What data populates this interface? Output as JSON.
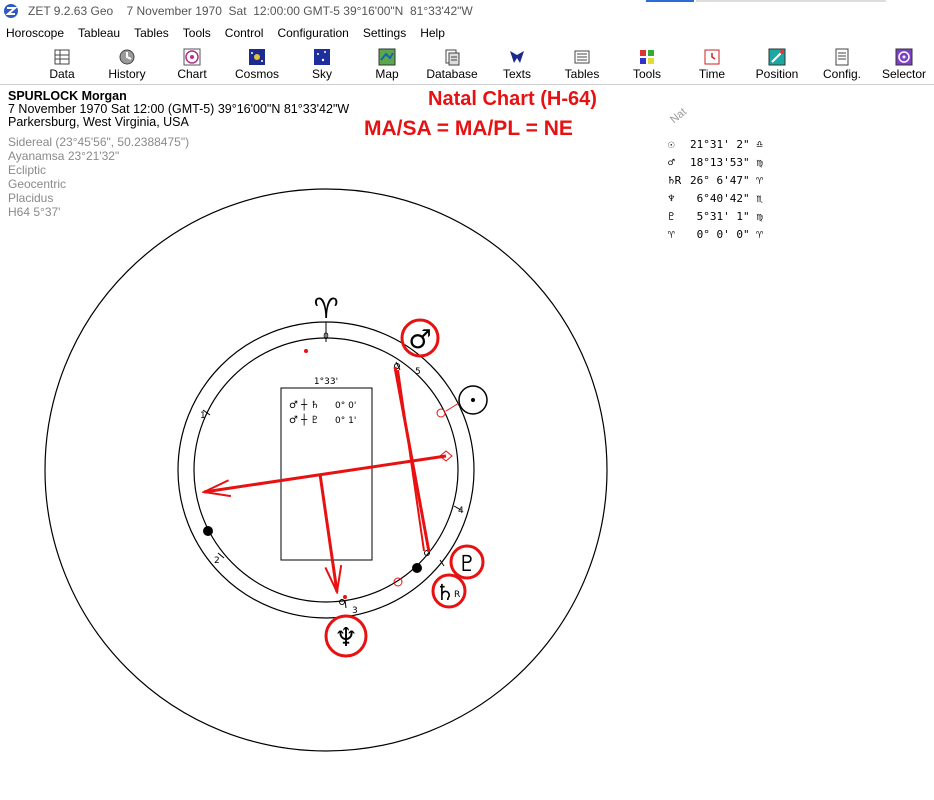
{
  "window": {
    "title": "ZET 9.2.63 Geo    7 November 1970  Sat  12:00:00 GMT-5 39°16'00\"N  81°33'42\"W"
  },
  "menu": [
    "Horoscope",
    "Tableau",
    "Tables",
    "Tools",
    "Control",
    "Configuration",
    "Settings",
    "Help"
  ],
  "toolbar": [
    {
      "label": "Data",
      "icon": "data-icon"
    },
    {
      "label": "History",
      "icon": "history-icon"
    },
    {
      "label": "Chart",
      "icon": "chart-icon"
    },
    {
      "label": "Cosmos",
      "icon": "cosmos-icon"
    },
    {
      "label": "Sky",
      "icon": "sky-icon"
    },
    {
      "label": "Map",
      "icon": "map-icon"
    },
    {
      "label": "Database",
      "icon": "database-icon"
    },
    {
      "label": "Texts",
      "icon": "texts-icon"
    },
    {
      "label": "Tables",
      "icon": "tables-icon"
    },
    {
      "label": "Tools",
      "icon": "tools-icon"
    },
    {
      "label": "Time",
      "icon": "time-icon"
    },
    {
      "label": "Position",
      "icon": "position-icon"
    },
    {
      "label": "Config.",
      "icon": "config-icon"
    },
    {
      "label": "Selector",
      "icon": "selector-icon"
    }
  ],
  "person": {
    "name": "SPURLOCK Morgan",
    "datetime": "7 November 1970  Sat  12:00 (GMT-5) 39°16'00\"N  81°33'42\"W",
    "place": "Parkersburg, West Virginia, USA"
  },
  "settings": [
    "Sidereal (23°45'56\", 50.2388475\")",
    "Ayanamsa 23°21'32\"",
    "Ecliptic",
    "Geocentric",
    "Placidus",
    "H64   5°37'"
  ],
  "annotation": {
    "line1": "Natal Chart (H-64)",
    "line2": "MA/SA = MA/PL = NE"
  },
  "legend": {
    "header": "Nat",
    "rows": [
      {
        "glyph": "☉",
        "text": "21°31' 2\"",
        "sign": "♎"
      },
      {
        "glyph": "♂",
        "text": "18°13'53\"",
        "sign": "♍"
      },
      {
        "glyph": "♄R",
        "text": "26° 6'47\"",
        "sign": "♈"
      },
      {
        "glyph": "♆",
        "text": " 6°40'42\"",
        "sign": "♏"
      },
      {
        "glyph": "♇",
        "text": " 5°31' 1\"",
        "sign": "♍"
      },
      {
        "glyph": "♈",
        "text": " 0° 0' 0\"",
        "sign": "♈"
      }
    ]
  },
  "chart": {
    "aries_glyph": "♈",
    "box_title": "1°33'",
    "box_rows": [
      {
        "glyphs": "♂ ┼ ♄",
        "value": "0° 0'"
      },
      {
        "glyphs": "♂ ┼ ♇",
        "value": "0° 1'"
      }
    ],
    "house_labels": [
      "0",
      "5",
      "1",
      "4",
      "2",
      "3"
    ],
    "planet_labels": {
      "mars": "♂",
      "sun": "☉",
      "pluto": "♇",
      "saturn": "♄",
      "saturn_retro": "R",
      "neptune": "♆"
    },
    "colors": {
      "accent": "#e81111",
      "ring": "#000000"
    }
  }
}
